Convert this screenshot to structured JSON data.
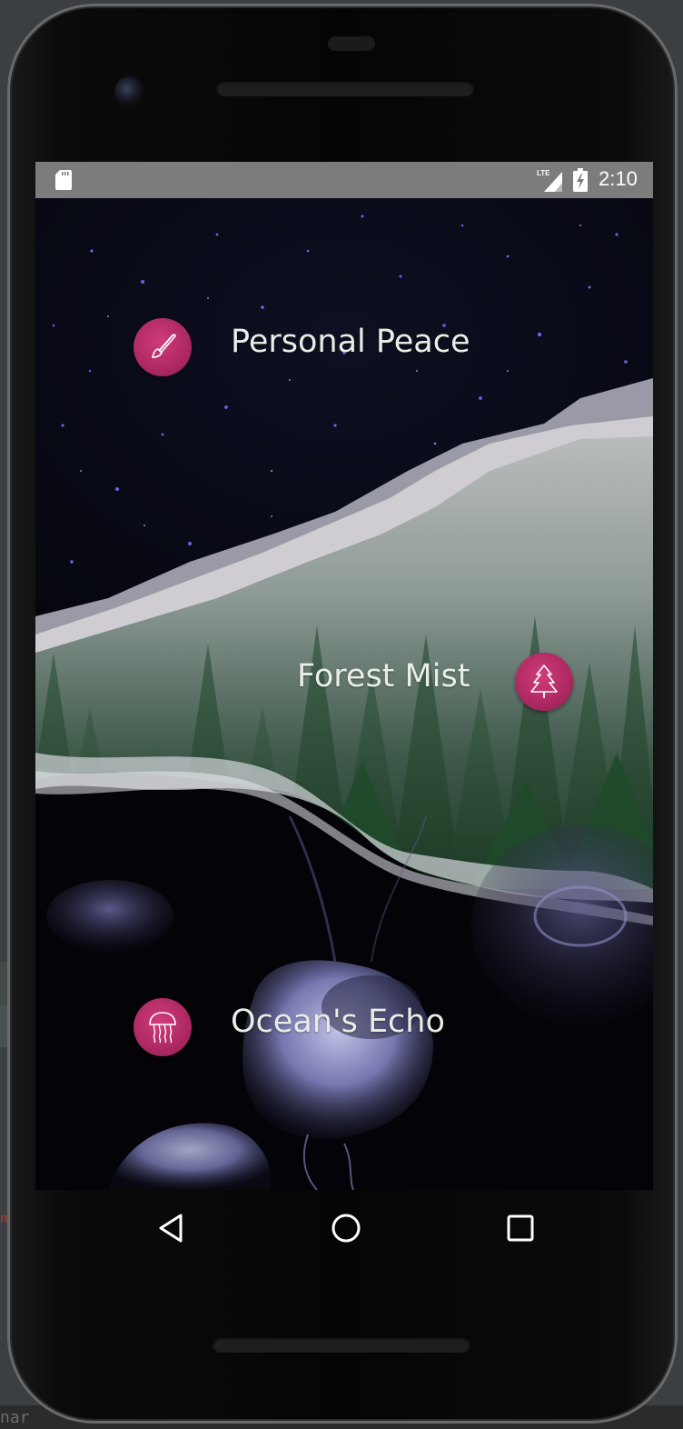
{
  "ide": {
    "bottom_text": "nar",
    "side_text": "n"
  },
  "status_bar": {
    "time": "2:10",
    "network_label": "LTE",
    "icons": [
      "sd-card-icon",
      "lte-signal-icon",
      "battery-charging-icon"
    ]
  },
  "menu": {
    "items": [
      {
        "label": "Personal Peace",
        "icon": "paintbrush-icon"
      },
      {
        "label": "Forest Mist",
        "icon": "pine-tree-icon"
      },
      {
        "label": "Ocean's Echo",
        "icon": "jellyfish-icon"
      }
    ]
  },
  "nav": {
    "icons": [
      "back-icon",
      "home-icon",
      "recents-icon"
    ]
  },
  "colors": {
    "status_bar": "#7c7c7c",
    "accent_icon": "#c0306f",
    "label_text": "#e9ede6"
  }
}
